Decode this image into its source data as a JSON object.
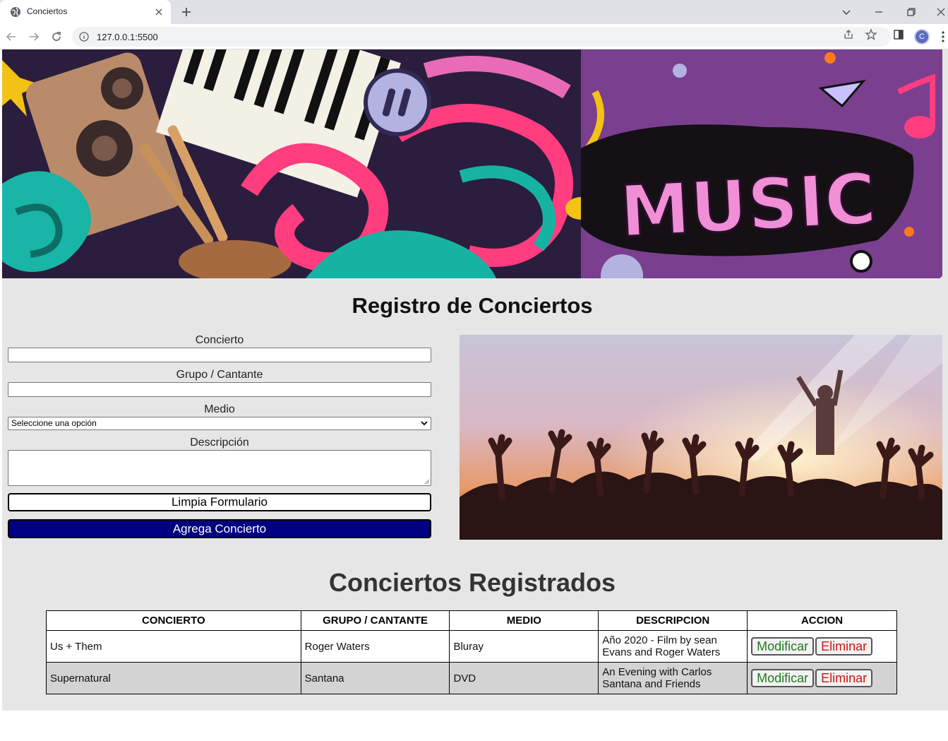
{
  "browser": {
    "tab_title": "Conciertos",
    "url": "127.0.0.1:5500",
    "profile_initial": "C"
  },
  "page": {
    "title": "Registro de Conciertos",
    "banner_text": "MUSIC"
  },
  "form": {
    "concierto_label": "Concierto",
    "grupo_label": "Grupo / Cantante",
    "medio_label": "Medio",
    "medio_selected": "Seleccione una opción",
    "descripcion_label": "Descripción",
    "clear_button": "Limpia Formulario",
    "add_button": "Agrega Concierto"
  },
  "registered": {
    "title": "Conciertos Registrados",
    "headers": [
      "CONCIERTO",
      "GRUPO / CANTANTE",
      "MEDIO",
      "DESCRIPCION",
      "ACCION"
    ],
    "modify_label": "Modificar",
    "delete_label": "Eliminar",
    "rows": [
      {
        "concierto": "Us + Them",
        "grupo": "Roger Waters",
        "medio": "Bluray",
        "descripcion": "Año 2020 - Film by sean Evans and Roger Waters"
      },
      {
        "concierto": "Supernatural",
        "grupo": "Santana",
        "medio": "DVD",
        "descripcion": "An Evening with Carlos Santana and Friends"
      }
    ]
  },
  "colors": {
    "add_button_bg": "#000080",
    "modify_text": "#1f7a1f",
    "delete_text": "#d01515",
    "page_bg": "#e6e6e6"
  }
}
